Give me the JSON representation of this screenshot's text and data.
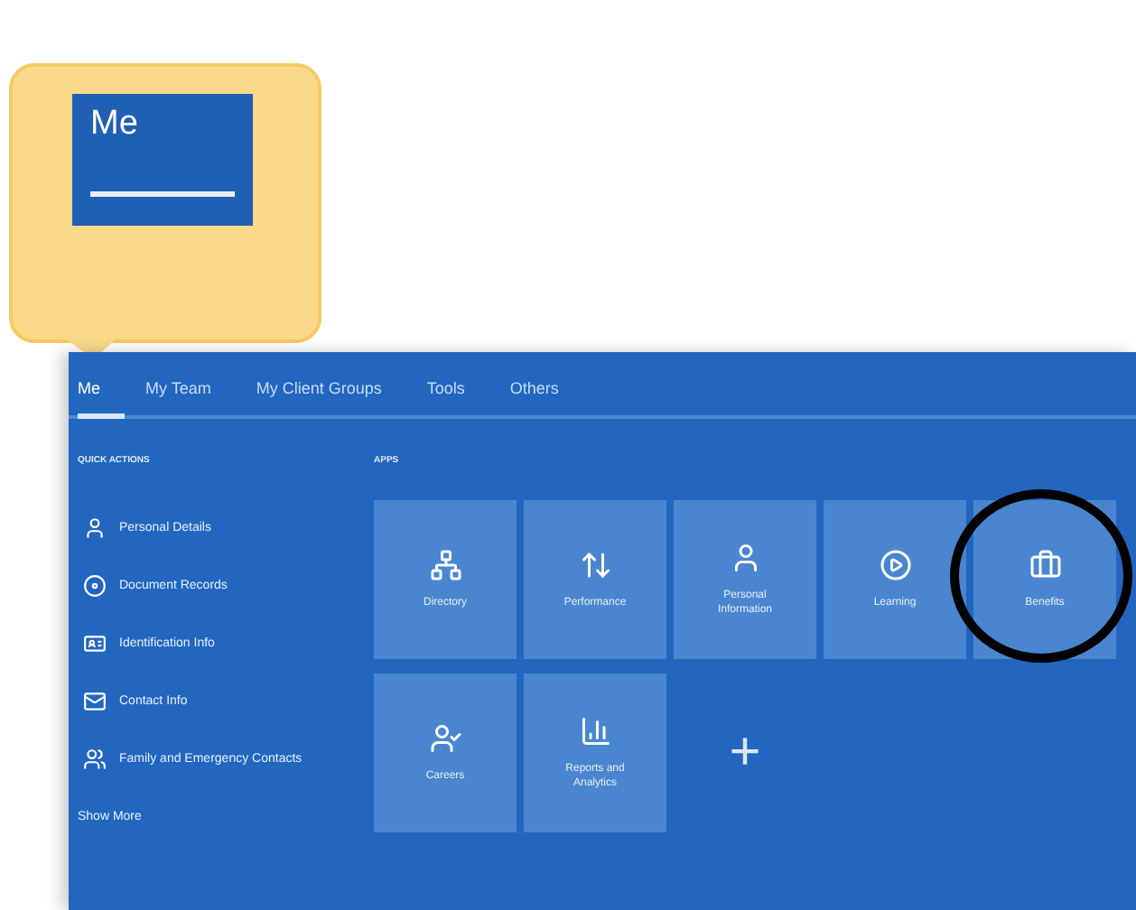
{
  "callout": {
    "label": "Me"
  },
  "tabs": [
    {
      "label": "Me",
      "selected": true
    },
    {
      "label": "My Team",
      "selected": false
    },
    {
      "label": "My Client Groups",
      "selected": false
    },
    {
      "label": "Tools",
      "selected": false
    },
    {
      "label": "Others",
      "selected": false
    }
  ],
  "quick_actions": {
    "heading": "QUICK ACTIONS",
    "items": [
      "Personal Details",
      "Document Records",
      "Identification Info",
      "Contact Info",
      "Family and Emergency Contacts"
    ],
    "show_more": "Show More"
  },
  "apps": {
    "heading": "APPS",
    "items": [
      {
        "kind": "app",
        "label": "Directory",
        "highlighted": false
      },
      {
        "kind": "app",
        "label": "Performance",
        "highlighted": false
      },
      {
        "kind": "app",
        "label": "Personal Information",
        "highlighted": false
      },
      {
        "kind": "app",
        "label": "Learning",
        "highlighted": false
      },
      {
        "kind": "app",
        "label": "Benefits",
        "highlighted": true
      },
      {
        "kind": "app",
        "label": "Careers",
        "highlighted": false
      },
      {
        "kind": "app",
        "label": "Reports and Analytics",
        "highlighted": false
      },
      {
        "kind": "add",
        "label": "+"
      }
    ]
  }
}
